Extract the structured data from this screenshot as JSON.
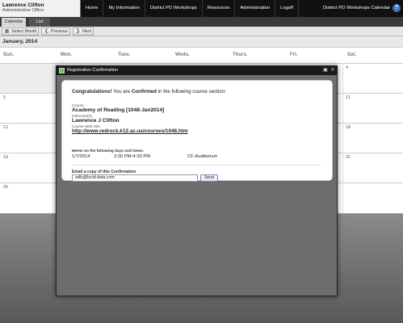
{
  "user": {
    "name": "Lawrence Clifton",
    "office": "Administrative Office"
  },
  "nav": {
    "items": [
      "Home",
      "My Information",
      "District PD Workshops",
      "Resources",
      "Administration",
      "Logoff"
    ]
  },
  "app_name": "District PD Workshops Calendar",
  "help_icon": "?",
  "tabs": [
    "Calendar",
    "List"
  ],
  "toolbar": {
    "select_month": "Select Month",
    "previous": "Previous",
    "next": "Next"
  },
  "calendar": {
    "month_label": "January, 2014",
    "days_of_week": [
      "Sun.",
      "Mon.",
      "Tues.",
      "Weds.",
      "Thurs.",
      "Fri.",
      "Sat."
    ],
    "sun_dates": [
      "5",
      "12",
      "19",
      "26"
    ],
    "sat_dates": [
      "4",
      "11",
      "18",
      "25"
    ]
  },
  "modal": {
    "title": "Registration Confirmation",
    "congrats_bold": "Congratulations!",
    "congrats_text1": " You are ",
    "congrats_confirmed": "Confirmed",
    "congrats_text2": " in the following course section:",
    "course_label": "Course:",
    "course_value": "Academy of Reading [1048-Jan2014]",
    "instructor_label": "Instructor(s):",
    "instructor_value": "Lawrence J Clifton",
    "website_label": "Course Web Site:",
    "website_value": "http://www.redrock.k12.az.us/courses/1048.htm",
    "meets_label": "Meets on the following days and times:",
    "session": {
      "date": "1/7/2014",
      "time": "3:30 PM-4:30 PM",
      "room": "CF-Auditorium"
    },
    "email_label": "Email a copy of this Confirmation",
    "email_value": "wills@lucid-data.com",
    "send_label": "Send"
  }
}
